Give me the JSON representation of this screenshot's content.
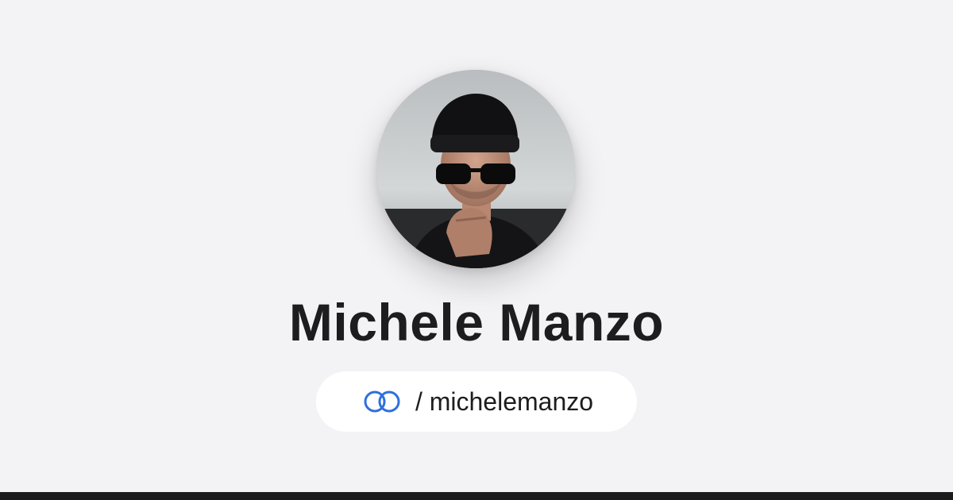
{
  "profile": {
    "name": "Michele Manzo",
    "handle": "/ michelemanzo",
    "avatar_icon": "profile-photo",
    "logo_icon": "linked-rings-icon"
  },
  "colors": {
    "background": "#f3f3f5",
    "text": "#1d1d1f",
    "pill": "#ffffff",
    "logo_accent": "#2f6fde",
    "bottom_bar": "#1b1b1d"
  }
}
